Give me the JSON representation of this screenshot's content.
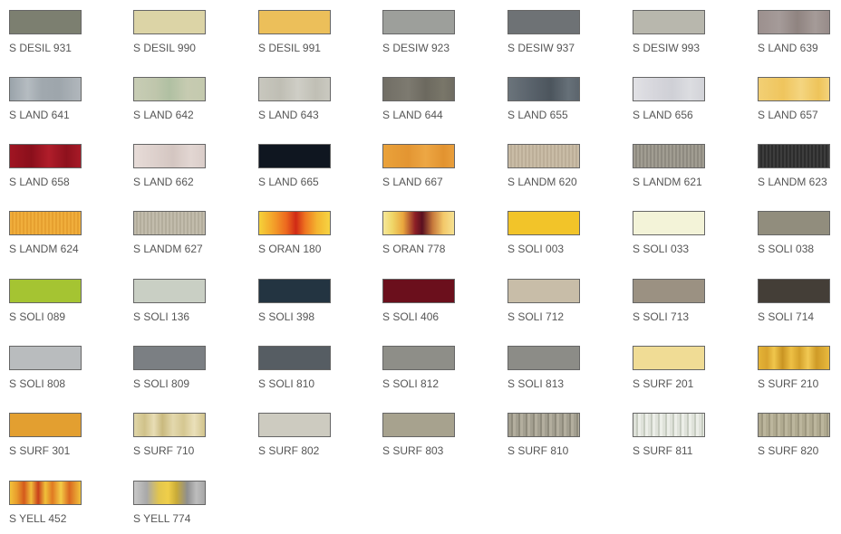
{
  "swatches": [
    {
      "label": "S DESIL 931",
      "bg": "#7c7f70"
    },
    {
      "label": "S DESIL 990",
      "bg": "#dcd4a6"
    },
    {
      "label": "S DESIL 991",
      "bg": "#ecbf5a"
    },
    {
      "label": "S DESIW 923",
      "bg": "#9d9f9b"
    },
    {
      "label": "S DESIW 937",
      "bg": "#6e7275"
    },
    {
      "label": "S DESIW 993",
      "bg": "#b8b7ad"
    },
    {
      "label": "S LAND 639",
      "bg": "linear-gradient(90deg,#9c908e 0%,#a59b99 30%,#8f8380 55%,#a59b98 80%,#978b89 100%)"
    },
    {
      "label": "S LAND 641",
      "bg": "linear-gradient(90deg,#9aa3aa 0%,#b5bcc1 25%,#a0a8ae 45%,#9ea6ac 70%,#b1b7bc 100%)"
    },
    {
      "label": "S LAND 642",
      "bg": "linear-gradient(90deg,#c8cdb5 0%,#bfc6ac 30%,#b0c0a2 50%,#c6cbb1 75%,#c4c9ae 100%)"
    },
    {
      "label": "S LAND 643",
      "bg": "linear-gradient(90deg,#c8c7be 0%,#bfbeb4 30%,#cfcec6 55%,#c0bfb5 80%,#cac9c0 100%)"
    },
    {
      "label": "S LAND 644",
      "bg": "linear-gradient(90deg,#716e65 0%,#7d7a70 35%,#6c695f 60%,#797669 85%,#6f6c62 100%)"
    },
    {
      "label": "S LAND 655",
      "bg": "linear-gradient(90deg,#6b747b 0%,#58616a 35%,#4c555d 60%,#667078 85%,#5c656d 100%)"
    },
    {
      "label": "S LAND 656",
      "bg": "linear-gradient(90deg,#e1e1e5 0%,#d6d6dc 30%,#cfd0d6 55%,#dcdde1 80%,#d2d3d8 100%)"
    },
    {
      "label": "S LAND 657",
      "bg": "linear-gradient(90deg,#f2cf74 0%,#efc55d 35%,#f4d580 60%,#eec45a 85%,#f3d27b 100%)"
    },
    {
      "label": "S LAND 658",
      "bg": "linear-gradient(90deg,#a01522 0%,#8a0f1b 30%,#b01d2a 55%,#8e111d 80%,#a71a27 100%)"
    },
    {
      "label": "S LAND 662",
      "bg": "linear-gradient(90deg,#e7dcd8 0%,#ddd0cc 30%,#d4c6c1 55%,#e2d6d2 80%,#dacdc9 100%)"
    },
    {
      "label": "S LAND 665",
      "bg": "#0f1620"
    },
    {
      "label": "S LAND 667",
      "bg": "linear-gradient(90deg,#eaa23a 0%,#e39532 35%,#eda744 60%,#e29330 85%,#e99f3c 100%)"
    },
    {
      "label": "S LANDM 620",
      "bg": "repeating-linear-gradient(90deg,#c9bca6 0px,#c9bca6 2px,#bcae98 2px,#bcae98 4px)"
    },
    {
      "label": "S LANDM 621",
      "bg": "repeating-linear-gradient(90deg,#a19d92 0px,#a19d92 2px,#8e8a80 2px,#8e8a80 4px)"
    },
    {
      "label": "S LANDM 623",
      "bg": "repeating-linear-gradient(90deg,#3d3d3d 0px,#3d3d3d 2px,#2c2c2c 2px,#2c2c2c 4px)"
    },
    {
      "label": "S LANDM 624",
      "bg": "repeating-linear-gradient(90deg,#f0ae3c 0px,#f0ae3c 2px,#e6a030 2px,#e6a030 4px)"
    },
    {
      "label": "S LANDM 627",
      "bg": "repeating-linear-gradient(90deg,#c2bcac 0px,#c2bcac 2px,#b3ad9c 2px,#b3ad9c 4px)"
    },
    {
      "label": "S ORAN 180",
      "bg": "linear-gradient(90deg,#f5d23a 0%,#f3a12a 20%,#ed6a1f 38%,#d02a15 52%,#ee7420 65%,#f4b530 82%,#f6d442 100%)"
    },
    {
      "label": "S ORAN 778",
      "bg": "linear-gradient(90deg,#f6e79a 0%,#f0d86a 12%,#e9a63e 28%,#8c1f26 45%,#5a1020 55%,#c77a3c 70%,#f3c86a 85%,#f6e291 100%)"
    },
    {
      "label": "S SOLI 003",
      "bg": "#f2c429"
    },
    {
      "label": "S SOLI 033",
      "bg": "#f3f3d8"
    },
    {
      "label": "S SOLI 038",
      "bg": "#918d7d"
    },
    {
      "label": "S SOLI 089",
      "bg": "#a5c432"
    },
    {
      "label": "S SOLI 136",
      "bg": "#c9cfc4"
    },
    {
      "label": "S SOLI 398",
      "bg": "#233441"
    },
    {
      "label": "S SOLI 406",
      "bg": "#6b0f1c"
    },
    {
      "label": "S SOLI 712",
      "bg": "#c8bda8"
    },
    {
      "label": "S SOLI 713",
      "bg": "#9b9182"
    },
    {
      "label": "S SOLI 714",
      "bg": "#443e37"
    },
    {
      "label": "S SOLI 808",
      "bg": "#b9bcbe"
    },
    {
      "label": "S SOLI 809",
      "bg": "#7b7f83"
    },
    {
      "label": "S SOLI 810",
      "bg": "#565d63"
    },
    {
      "label": "S SOLI 812",
      "bg": "#8e8e88"
    },
    {
      "label": "S SOLI 813",
      "bg": "#8c8c87"
    },
    {
      "label": "S SURF 201",
      "bg": "#f0dc95"
    },
    {
      "label": "S SURF 210",
      "bg": "linear-gradient(90deg,#e5b437 0%,#d9a42e 12%,#f0c64c 22%,#c99422 34%,#eec045 46%,#d4a12b 58%,#f2c953 70%,#cf9b27 82%,#e8b93e 100%)"
    },
    {
      "label": "S SURF 301",
      "bg": "#e39f30"
    },
    {
      "label": "S SURF 710",
      "bg": "linear-gradient(90deg,#e0d6a8 0%,#d0c28a 15%,#e8ddb5 28%,#c9b97e 40%,#e3d8ad 55%,#d5c791 70%,#eae0ba 85%,#d2c48c 100%)"
    },
    {
      "label": "S SURF 802",
      "bg": "#cdcbc0"
    },
    {
      "label": "S SURF 803",
      "bg": "#a7a28e"
    },
    {
      "label": "S SURF 810",
      "bg": "repeating-linear-gradient(90deg,#a39f90 0px,#a39f90 3px,#8f8b7c 3px,#8f8b7c 5px,#b3ae9e 5px,#b3ae9e 8px)"
    },
    {
      "label": "S SURF 811",
      "bg": "repeating-linear-gradient(90deg,#dfe2da 0px,#dfe2da 3px,#c6cbc0 3px,#c6cbc0 5px,#eceee8 5px,#eceee8 8px)"
    },
    {
      "label": "S SURF 820",
      "bg": "repeating-linear-gradient(90deg,#b0aa90 0px,#b0aa90 3px,#9e9880 3px,#9e9880 5px,#bcb69d 5px,#bcb69d 8px)"
    },
    {
      "label": "S YELL 452",
      "bg": "linear-gradient(90deg,#f2c23a 0%,#e89a2c 10%,#d45a1c 20%,#f1bc3a 30%,#c8401a 40%,#f0c03a 50%,#e07a22 60%,#f4cb46 72%,#d96820 84%,#f1c13c 100%)"
    },
    {
      "label": "S YELL 774",
      "bg": "linear-gradient(90deg,#c8c8c8 0%,#a9a9a9 18%,#e2c54e 35%,#f0cf4a 48%,#c9ab38 60%,#8f8f8f 75%,#bdbdbd 88%,#a7a7a7 100%)"
    }
  ]
}
